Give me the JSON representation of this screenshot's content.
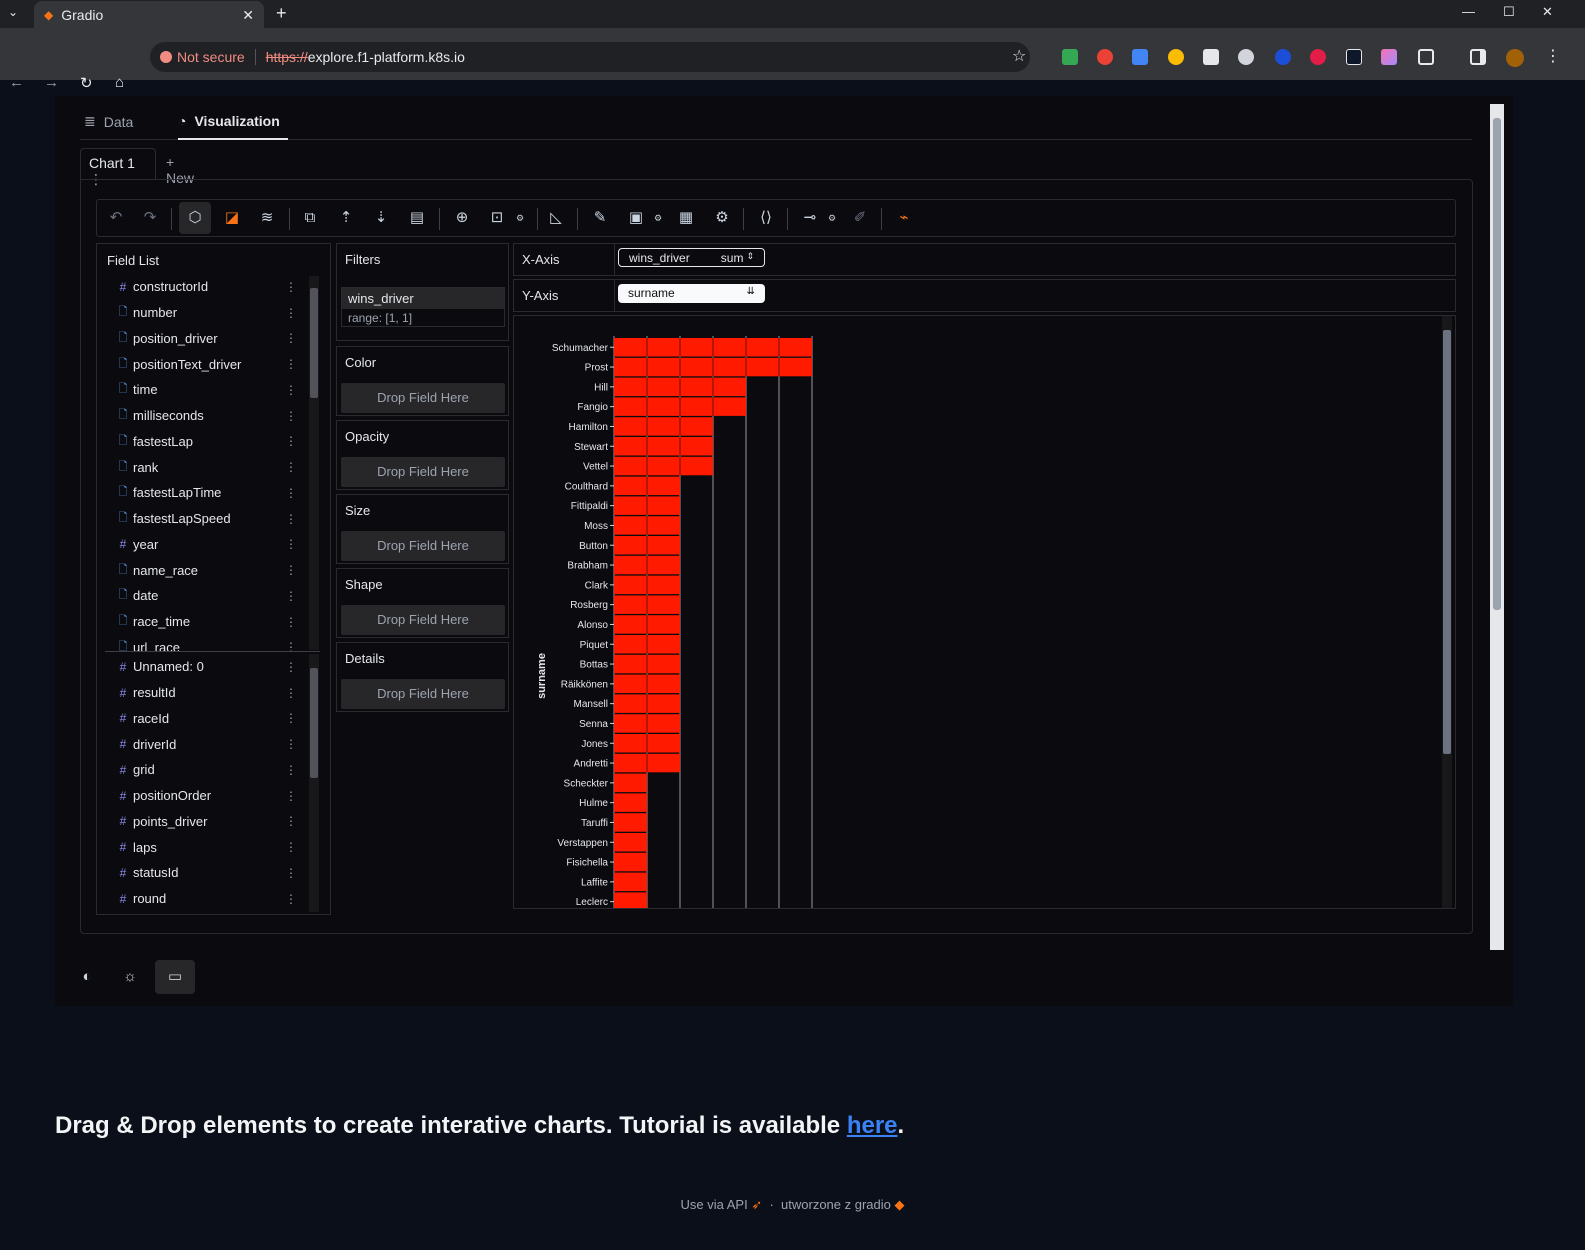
{
  "browser": {
    "tab_title": "Gradio",
    "security_label": "Not secure",
    "url_scheme": "https://",
    "url_rest": "explore.f1-platform.k8s.io"
  },
  "nav": {
    "data": "Data",
    "visualization": "Visualization"
  },
  "chart_tabs": {
    "chart1": "Chart 1",
    "new": "+ New"
  },
  "field_list": {
    "title": "Field List",
    "dimensions": [
      {
        "name": "constructorId",
        "type": "#"
      },
      {
        "name": "number",
        "type": "doc"
      },
      {
        "name": "position_driver",
        "type": "doc"
      },
      {
        "name": "positionText_driver",
        "type": "doc"
      },
      {
        "name": "time",
        "type": "doc"
      },
      {
        "name": "milliseconds",
        "type": "doc"
      },
      {
        "name": "fastestLap",
        "type": "doc"
      },
      {
        "name": "rank",
        "type": "doc"
      },
      {
        "name": "fastestLapTime",
        "type": "doc"
      },
      {
        "name": "fastestLapSpeed",
        "type": "doc"
      },
      {
        "name": "year",
        "type": "#"
      },
      {
        "name": "name_race",
        "type": "doc"
      },
      {
        "name": "date",
        "type": "doc"
      },
      {
        "name": "race_time",
        "type": "doc"
      },
      {
        "name": "url_race",
        "type": "doc"
      }
    ],
    "measures": [
      {
        "name": "Unnamed: 0",
        "type": "#"
      },
      {
        "name": "resultId",
        "type": "#"
      },
      {
        "name": "raceId",
        "type": "#"
      },
      {
        "name": "driverId",
        "type": "#"
      },
      {
        "name": "grid",
        "type": "#"
      },
      {
        "name": "positionOrder",
        "type": "#"
      },
      {
        "name": "points_driver",
        "type": "#"
      },
      {
        "name": "laps",
        "type": "#"
      },
      {
        "name": "statusId",
        "type": "#"
      },
      {
        "name": "round",
        "type": "#"
      }
    ]
  },
  "filters": {
    "title": "Filters",
    "field": "wins_driver",
    "range": "range: [1, 1]"
  },
  "channels": {
    "color": "Color",
    "opacity": "Opacity",
    "size": "Size",
    "shape": "Shape",
    "details": "Details",
    "drop": "Drop Field Here"
  },
  "axes": {
    "x_label": "X-Axis",
    "x_field": "wins_driver",
    "x_agg": "sum",
    "y_label": "Y-Axis",
    "y_field": "surname"
  },
  "chart_data": {
    "type": "bar",
    "orientation": "horizontal",
    "ylabel": "surname",
    "bar_color": "#ff1a00",
    "categories": [
      "Schumacher",
      "Prost",
      "Hill",
      "Fangio",
      "Hamilton",
      "Stewart",
      "Vettel",
      "Coulthard",
      "Fittipaldi",
      "Moss",
      "Button",
      "Brabham",
      "Clark",
      "Rosberg",
      "Alonso",
      "Piquet",
      "Bottas",
      "Räikkönen",
      "Mansell",
      "Senna",
      "Jones",
      "Andretti",
      "Scheckter",
      "Hulme",
      "Taruffi",
      "Verstappen",
      "Fisichella",
      "Laffite",
      "Leclerc"
    ],
    "values": [
      6,
      6,
      4,
      4,
      3,
      3,
      3,
      2,
      2,
      2,
      2,
      2,
      2,
      2,
      2,
      2,
      2,
      2,
      2,
      2,
      2,
      2,
      1,
      1,
      1,
      1,
      1,
      1,
      1
    ],
    "grid": true
  },
  "footer": {
    "message": "Drag & Drop elements to create interative charts. Tutorial is available ",
    "link": "here",
    "period": ".",
    "api": "Use via API",
    "sep": "·",
    "made": "utworzone z gradio"
  }
}
